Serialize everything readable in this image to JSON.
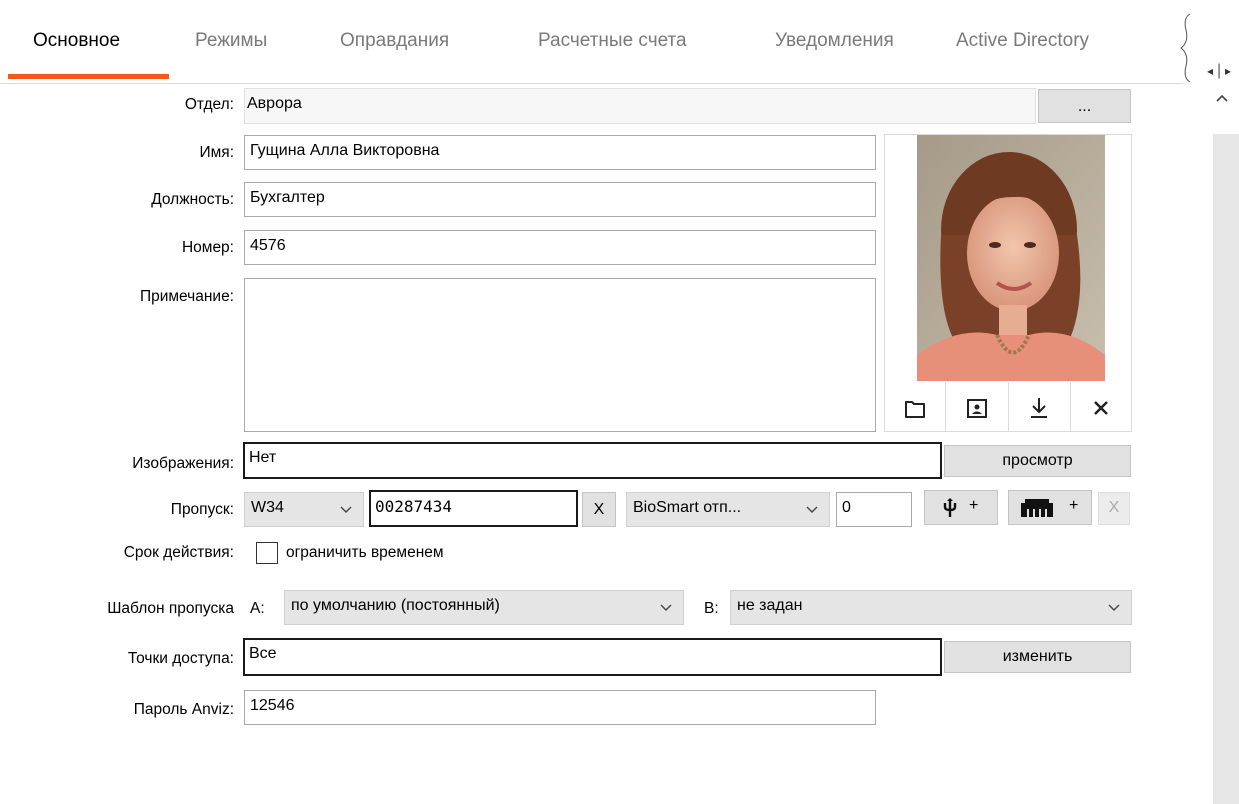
{
  "tabs": [
    {
      "label": "Основное",
      "active": true
    },
    {
      "label": "Режимы"
    },
    {
      "label": "Оправдания"
    },
    {
      "label": "Расчетные счета"
    },
    {
      "label": "Уведомления"
    },
    {
      "label": "Active Directory"
    }
  ],
  "colors": {
    "accent": "#f05a1a"
  },
  "form": {
    "department": {
      "label": "Отдел:",
      "value": "Аврора",
      "button": "..."
    },
    "name": {
      "label": "Имя:",
      "value": "Гущина Алла Викторовна"
    },
    "position": {
      "label": "Должность:",
      "value": "Бухгалтер"
    },
    "number": {
      "label": "Номер:",
      "value": "4576"
    },
    "note": {
      "label": "Примечание:",
      "value": ""
    },
    "images": {
      "label": "Изображения:",
      "value": "Нет",
      "button": "просмотр"
    },
    "pass": {
      "label": "Пропуск:",
      "format": "W34",
      "code": "00287434",
      "clear": "X",
      "device": "BioSmart отп...",
      "count": "0",
      "usb_plus": "+",
      "reader_plus": "+",
      "clear2": "X"
    },
    "validity": {
      "label": "Срок действия:",
      "checkbox_label": "ограничить временем",
      "checked": false
    },
    "template": {
      "label": "Шаблон пропуска",
      "a_label": "A:",
      "a_value": "по умолчанию (постоянный)",
      "b_label": "B:",
      "b_value": "не задан"
    },
    "access_points": {
      "label": "Точки доступа:",
      "value": "Все",
      "button": "изменить"
    },
    "anviz": {
      "label": "Пароль Anviz:",
      "value": "12546"
    }
  },
  "photo": {
    "icons": [
      "folder-icon",
      "portrait-icon",
      "download-icon",
      "close-icon"
    ]
  }
}
